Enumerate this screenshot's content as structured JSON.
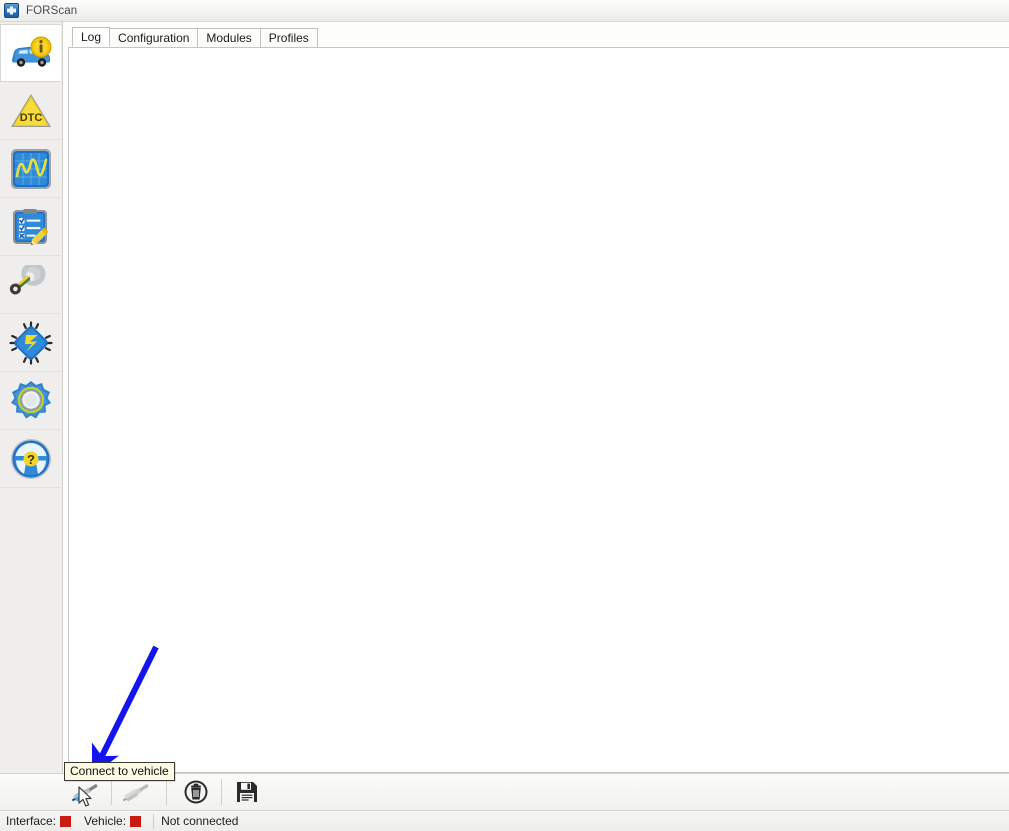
{
  "window": {
    "title": "FORScan",
    "app_icon": "forscan-app-icon"
  },
  "sidebar": {
    "items": [
      {
        "label": "Vehicle information",
        "icon": "car-info-icon",
        "selected": true
      },
      {
        "label": "DTC",
        "icon": "dtc-warning-triangle-icon",
        "selected": false
      },
      {
        "label": "PID / Data logger",
        "icon": "oscilloscope-graph-icon",
        "selected": false
      },
      {
        "label": "Tests",
        "icon": "checklist-pencil-icon",
        "selected": false
      },
      {
        "label": "Service procedures",
        "icon": "wrench-icon",
        "selected": false
      },
      {
        "label": "Configuration and programming",
        "icon": "microchip-icon",
        "selected": false
      },
      {
        "label": "Settings",
        "icon": "gear-settings-icon",
        "selected": false
      },
      {
        "label": "Help",
        "icon": "steering-wheel-question-icon",
        "selected": false
      }
    ]
  },
  "main": {
    "tabs": [
      {
        "label": "Log",
        "active": true
      },
      {
        "label": "Configuration",
        "active": false
      },
      {
        "label": "Modules",
        "active": false
      },
      {
        "label": "Profiles",
        "active": false
      }
    ],
    "log_text": ""
  },
  "toolbar": {
    "buttons": [
      {
        "name": "connect-to-vehicle-button",
        "label": "Connect to vehicle",
        "icon": "connector-plug-blue-icon",
        "enabled": true
      },
      {
        "name": "disconnect-from-vehicle-button",
        "label": "Disconnect from vehicle",
        "icon": "connector-plug-gray-icon",
        "enabled": false
      },
      {
        "name": "clear-log-button",
        "label": "Clear log",
        "icon": "trash-icon",
        "enabled": true
      },
      {
        "name": "save-log-button",
        "label": "Save log",
        "icon": "floppy-save-icon",
        "enabled": true
      }
    ]
  },
  "statusbar": {
    "interface_label": "Interface:",
    "vehicle_label": "Vehicle:",
    "connection_status": "Not connected",
    "interface_led_color": "#c81b14",
    "vehicle_led_color": "#c81b14"
  },
  "tooltip": {
    "text": "Connect to vehicle"
  },
  "annotation": {
    "arrow_color": "#1414f0",
    "arrow_name": "pointer-arrow-to-connect-button"
  }
}
